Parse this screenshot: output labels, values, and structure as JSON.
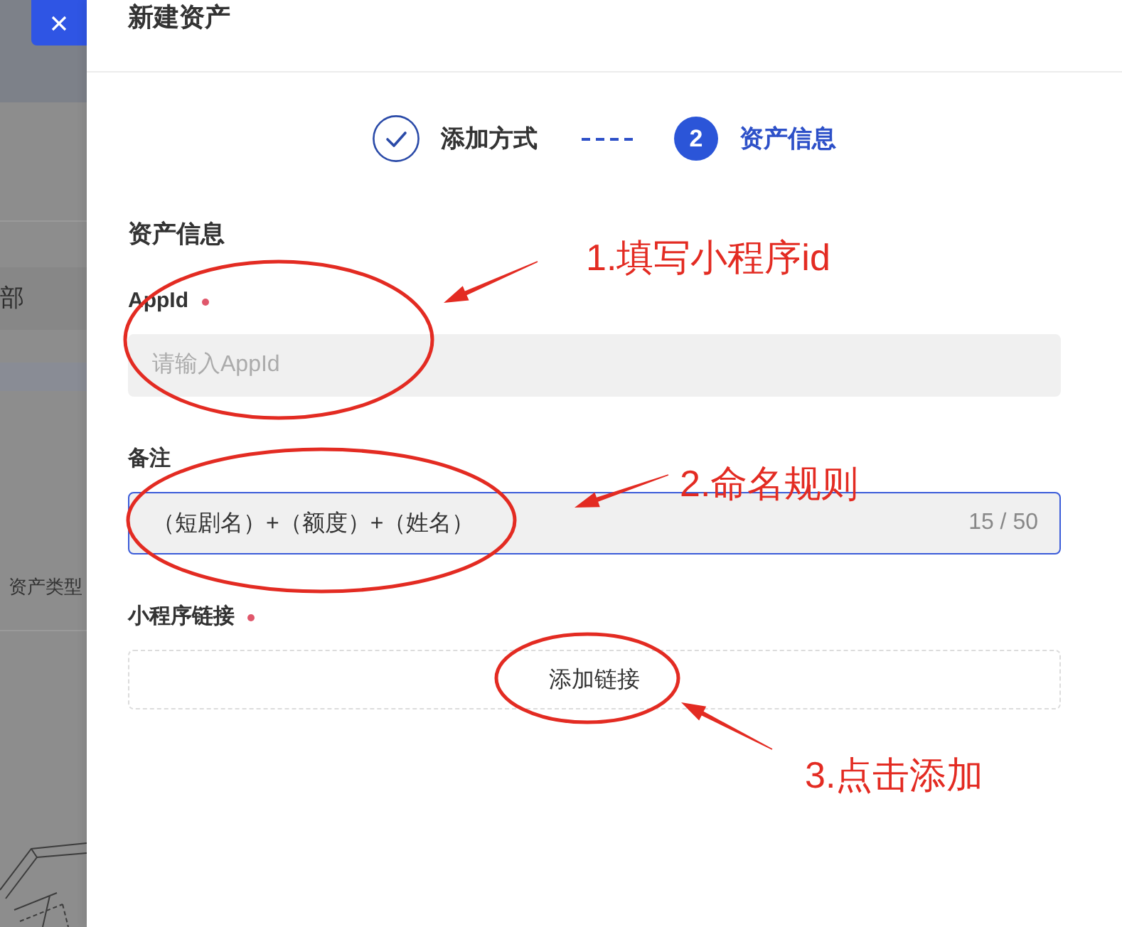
{
  "backdrop": {
    "menu_item": "部",
    "column_header": "资产类型"
  },
  "drawer": {
    "title": "新建资产"
  },
  "steps": [
    {
      "label": "添加方式",
      "done": true,
      "selected": false
    },
    {
      "number": "2",
      "label": "资产信息",
      "done": false,
      "selected": true
    }
  ],
  "form": {
    "section_title": "资产信息",
    "fields": [
      {
        "kind": "text",
        "label": "AppId",
        "required": true,
        "placeholder": "请输入AppId",
        "focused": false
      },
      {
        "kind": "text",
        "label": "备注",
        "required": false,
        "value": "（短剧名）+（额度）+（姓名）",
        "counter": "15 / 50",
        "focused": true
      },
      {
        "kind": "link_list",
        "label": "小程序链接",
        "required": true,
        "button": "添加链接",
        "focused": false
      }
    ]
  },
  "annotations": [
    {
      "text": "1.填写小程序id"
    },
    {
      "text": "2.命名规则"
    },
    {
      "text": "3.点击添加"
    }
  ]
}
